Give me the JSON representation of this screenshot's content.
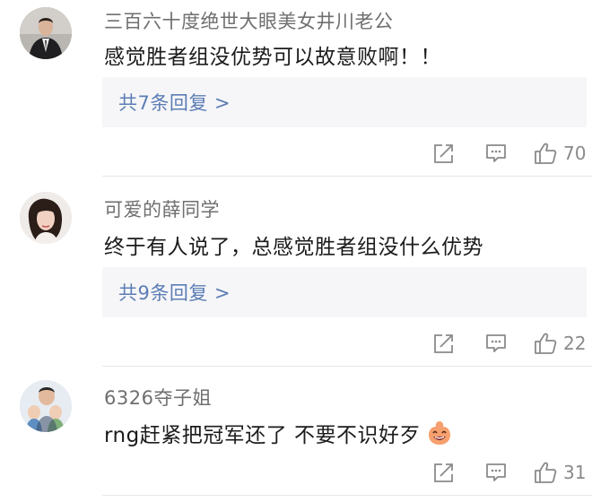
{
  "comments": [
    {
      "username": "三百六十度绝世大眼美女井川老公",
      "content": "感觉胜者组没优势可以故意败啊！！",
      "replies": "共7条回复 >",
      "likes": "70"
    },
    {
      "username": "可爱的薛同学",
      "content": "终于有人说了，总感觉胜者组没什么优势",
      "replies": "共9条回复 >",
      "likes": "22"
    },
    {
      "username": "6326夺子姐",
      "content": "rng赶紧把冠军还了 不要不识好歹",
      "likes": "31"
    }
  ],
  "icons": {
    "share": "share-icon",
    "comment": "comment-icon",
    "like": "thumbs-up-icon",
    "emoji": "laughing-emoji-icon"
  },
  "colors": {
    "reply_link": "#5c7db5",
    "username": "#6f6f6f",
    "reply_bg": "#f6f6f8"
  }
}
